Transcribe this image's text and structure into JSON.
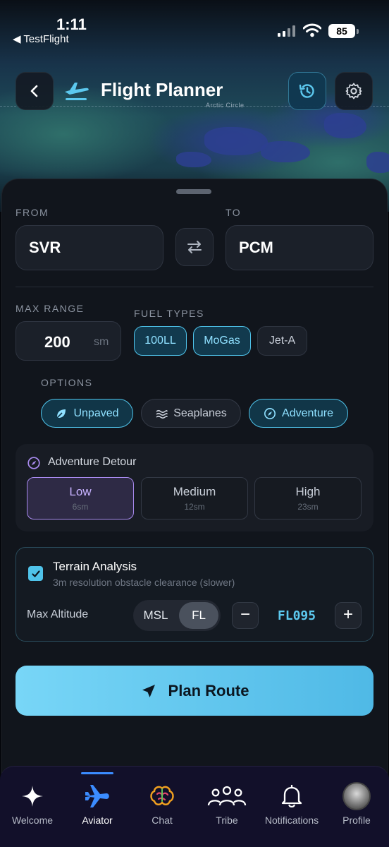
{
  "status_bar": {
    "time": "1:11",
    "back_app": "◀ TestFlight",
    "battery": "85"
  },
  "map": {
    "arctic_label": "Arctic Circle"
  },
  "header": {
    "title": "Flight Planner"
  },
  "route": {
    "from_label": "FROM",
    "from_value": "SVR",
    "to_label": "TO",
    "to_value": "PCM"
  },
  "range": {
    "label": "MAX RANGE",
    "value": "200",
    "unit": "sm"
  },
  "fuel": {
    "label": "FUEL TYPES",
    "types": [
      {
        "label": "100LL",
        "selected": true
      },
      {
        "label": "MoGas",
        "selected": true
      },
      {
        "label": "Jet-A",
        "selected": false
      }
    ]
  },
  "options": {
    "label": "OPTIONS",
    "items": [
      {
        "label": "Unpaved",
        "selected": true,
        "icon": "leaf-icon"
      },
      {
        "label": "Seaplanes",
        "selected": false,
        "icon": "waves-icon"
      },
      {
        "label": "Adventure",
        "selected": true,
        "icon": "compass-icon"
      }
    ]
  },
  "detour": {
    "title": "Adventure Detour",
    "levels": [
      {
        "name": "Low",
        "distance": "6sm",
        "selected": true
      },
      {
        "name": "Medium",
        "distance": "12sm",
        "selected": false
      },
      {
        "name": "High",
        "distance": "23sm",
        "selected": false
      }
    ]
  },
  "terrain": {
    "checked": true,
    "title": "Terrain Analysis",
    "subtitle": "3m resolution obstacle clearance (slower)",
    "alt_label": "Max Altitude",
    "mode_msl": "MSL",
    "mode_fl": "FL",
    "selected_mode": "FL",
    "altitude_value": "FL095",
    "decrement": "−",
    "increment": "+"
  },
  "plan_button": {
    "label": "Plan Route"
  },
  "tabs": [
    {
      "label": "Welcome",
      "icon": "sparkle-icon"
    },
    {
      "label": "Aviator",
      "icon": "airplane-icon",
      "active": true
    },
    {
      "label": "Chat",
      "icon": "brain-icon"
    },
    {
      "label": "Tribe",
      "icon": "group-icon"
    },
    {
      "label": "Notifications",
      "icon": "bell-icon"
    },
    {
      "label": "Profile",
      "icon": "avatar"
    }
  ],
  "colors": {
    "accent": "#4fc3ea",
    "adventure_purple": "#a98bf0",
    "tab_active": "#3b8cff"
  }
}
